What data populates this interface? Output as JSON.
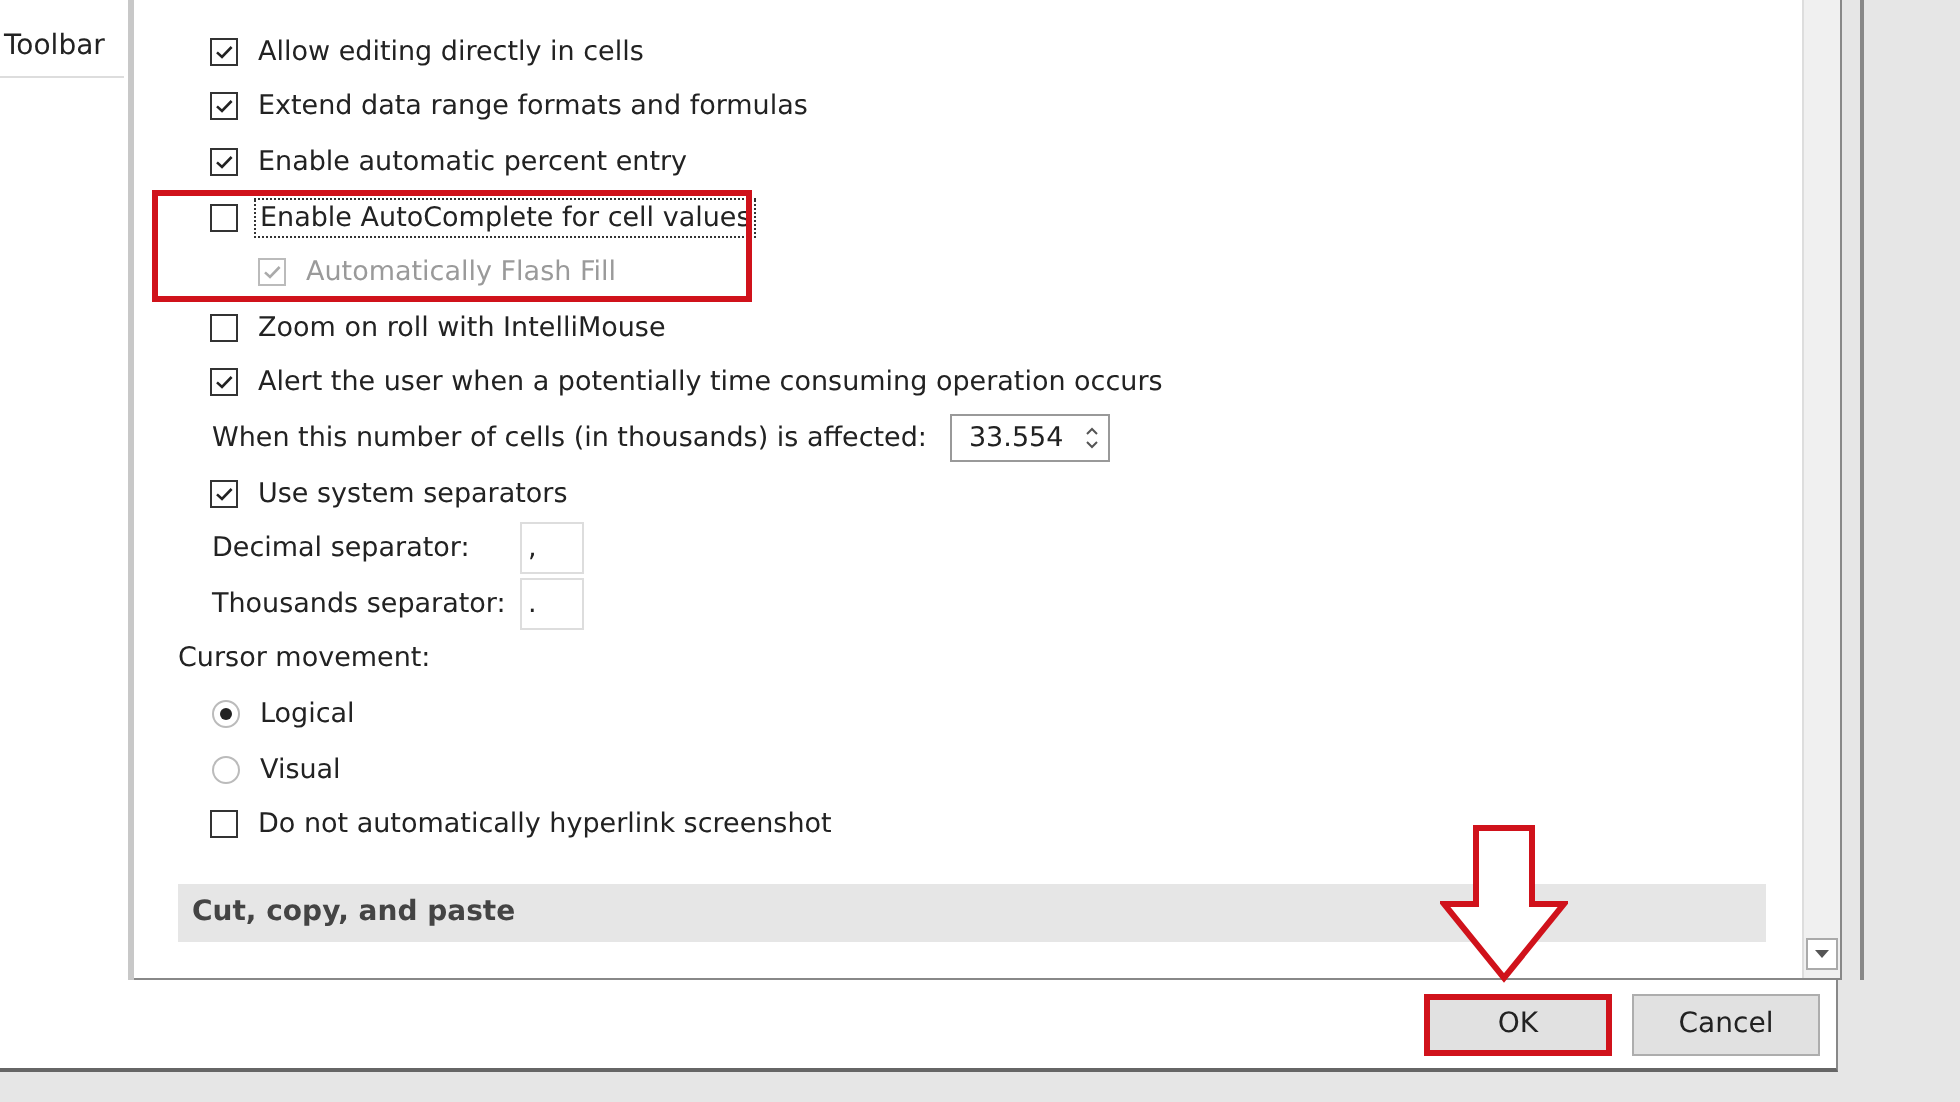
{
  "sidebar": {
    "items": [
      {
        "label": "Toolbar"
      }
    ]
  },
  "options": [
    {
      "kind": "checkbox",
      "label": "Allow editing directly in cells",
      "checked": true,
      "disabled": false
    },
    {
      "kind": "checkbox",
      "label": "Extend data range formats and formulas",
      "checked": true,
      "disabled": false
    },
    {
      "kind": "checkbox",
      "label": "Enable automatic percent entry",
      "checked": true,
      "disabled": false
    },
    {
      "kind": "checkbox",
      "label": "Enable AutoComplete for cell values",
      "checked": false,
      "disabled": false,
      "focused": true,
      "highlighted": true,
      "children": [
        {
          "kind": "checkbox",
          "label": "Automatically Flash Fill",
          "checked": true,
          "disabled": true
        }
      ]
    },
    {
      "kind": "checkbox",
      "label": "Zoom on roll with IntelliMouse",
      "checked": false,
      "disabled": false
    },
    {
      "kind": "checkbox",
      "label": "Alert the user when a potentially time consuming operation occurs",
      "checked": true,
      "disabled": false,
      "children": [
        {
          "kind": "spinner",
          "label": "When this number of cells (in thousands) is affected:",
          "value": "33.554"
        }
      ]
    },
    {
      "kind": "checkbox",
      "label": "Use system separators",
      "checked": true,
      "disabled": false,
      "children": [
        {
          "kind": "text-field",
          "label": "Decimal separator:",
          "value": ","
        },
        {
          "kind": "text-field",
          "label": "Thousands separator:",
          "value": "."
        }
      ]
    },
    {
      "kind": "label",
      "label": "Cursor movement:",
      "children": [
        {
          "kind": "radio",
          "label": "Logical",
          "selected": true
        },
        {
          "kind": "radio",
          "label": "Visual",
          "selected": false
        }
      ]
    },
    {
      "kind": "checkbox",
      "label": "Do not automatically hyperlink screenshot",
      "checked": false,
      "disabled": false
    }
  ],
  "section": {
    "title": "Cut, copy, and paste"
  },
  "buttons": [
    {
      "label": "OK",
      "highlighted": true
    },
    {
      "label": "Cancel",
      "highlighted": false
    }
  ]
}
